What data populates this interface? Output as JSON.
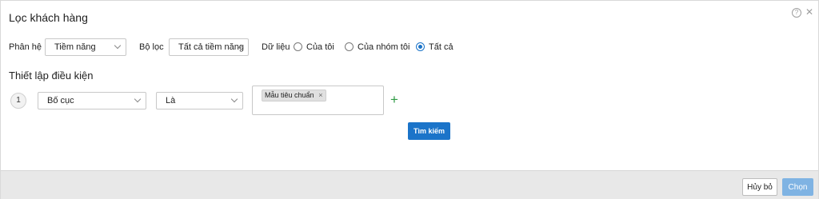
{
  "dialog": {
    "title": "Lọc khách hàng",
    "help_icon": "?",
    "close_icon": "✕"
  },
  "filters": {
    "subsystem": {
      "label": "Phân hệ",
      "value": "Tiềm năng"
    },
    "filter": {
      "label": "Bộ lọc",
      "value": "Tất cả tiềm năng"
    },
    "data": {
      "label": "Dữ liệu",
      "options": [
        {
          "label": "Của tôi",
          "checked": false
        },
        {
          "label": "Của nhóm tôi",
          "checked": false
        },
        {
          "label": "Tất cả",
          "checked": true
        }
      ]
    }
  },
  "conditions": {
    "title": "Thiết lập điều kiện",
    "rows": [
      {
        "index": "1",
        "field": "Bố cục",
        "operator": "Là",
        "values": [
          "Mẫu tiêu chuẩn"
        ]
      }
    ],
    "tag_remove": "×",
    "add_icon": "+",
    "search_label": "Tìm kiếm"
  },
  "footer": {
    "cancel_label": "Hủy bỏ",
    "choose_label": "Chọn"
  },
  "colors": {
    "primary": "#1b74c9",
    "primary_disabled": "#7fb3e3",
    "add": "#2e9a44"
  }
}
